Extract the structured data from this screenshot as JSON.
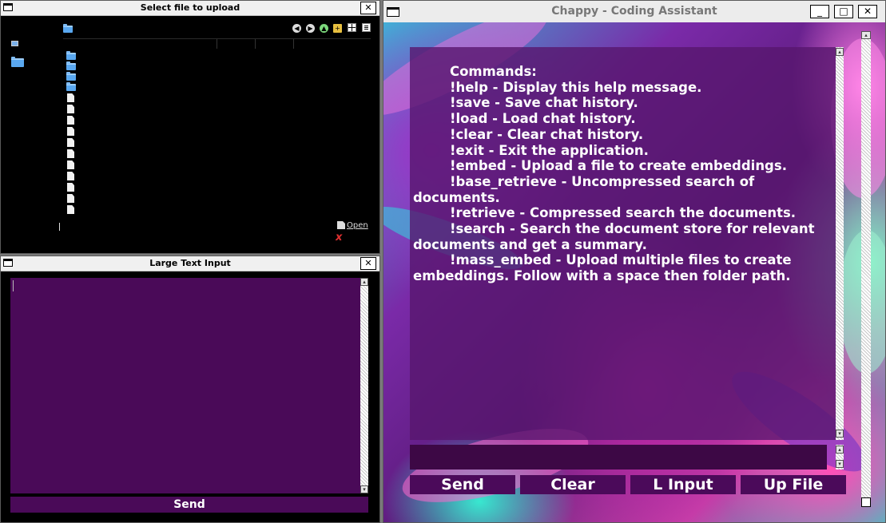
{
  "file_dialog": {
    "title": "Select file to upload",
    "close": "✕",
    "open_label": "Open",
    "cancel_glyph": "x",
    "toolbar_icons": [
      "back-icon",
      "forward-icon",
      "up-icon",
      "new-folder-icon",
      "icon-view-icon",
      "list-view-icon"
    ]
  },
  "large_input": {
    "title": "Large Text Input",
    "close": "✕",
    "text_value": "",
    "send_label": "Send"
  },
  "chappy": {
    "title": "Chappy - Coding Assistant",
    "minimize": "_",
    "maximize": "□",
    "close": "✕",
    "chat_text": "        Commands:\n        !help - Display this help message.\n        !save - Save chat history.\n        !load - Load chat history.\n        !clear - Clear chat history.\n        !exit - Exit the application.\n        !embed - Upload a file to create embeddings.\n        !base_retrieve - Uncompressed search of documents.\n        !retrieve - Compressed search the documents.\n        !search - Search the document store for relevant documents and get a summary.\n        !mass_embed - Upload multiple files to create embeddings. Follow with a space then folder path.",
    "input_value": "",
    "buttons": {
      "send": "Send",
      "clear": "Clear",
      "l_input": "L Input",
      "up_file": "Up File"
    }
  },
  "colors": {
    "panel_purple": "#4b0a5a",
    "input_purple": "#3d0845",
    "text": "#ffffff"
  }
}
